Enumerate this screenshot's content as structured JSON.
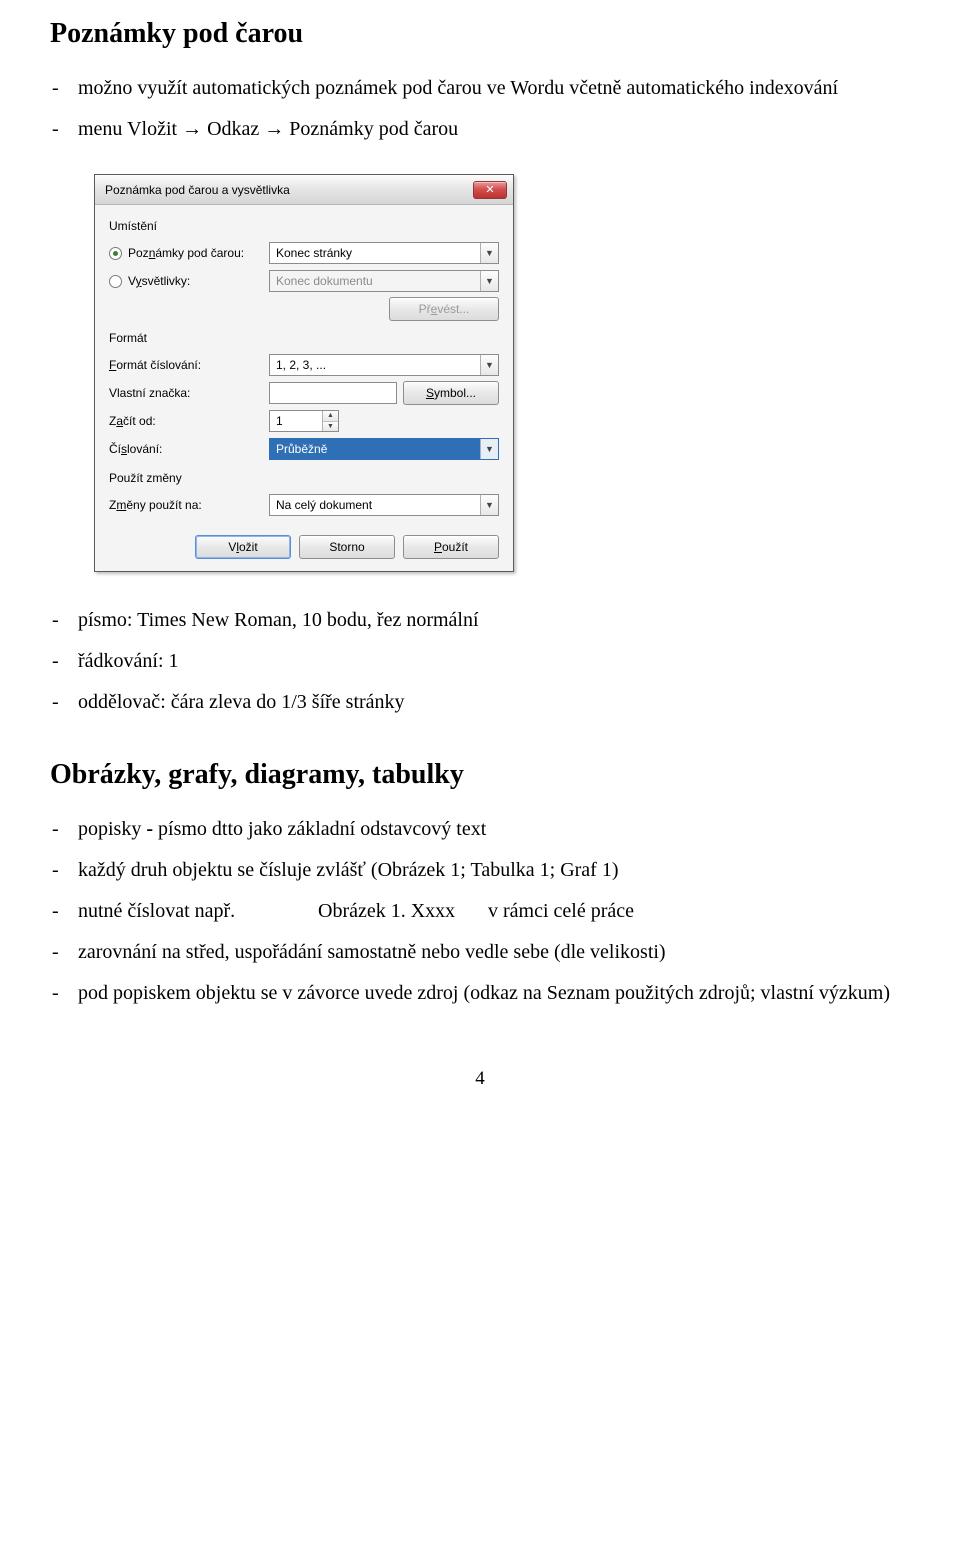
{
  "sections": {
    "footnotes_title": "Poznámky pod čarou",
    "footnotes_items": [
      "možno využít automatických poznámek pod čarou ve Wordu včetně automatického indexování",
      "menu Vložit → Odkaz → Poznámky pod čarou"
    ],
    "font_items": [
      "písmo: Times New Roman, 10 bodu, řez normální",
      "řádkování: 1",
      "oddělovač: čára zleva do 1/3 šíře stránky"
    ],
    "images_title": "Obrázky, grafy, diagramy, tabulky",
    "img_i1_pref": "popisky ",
    "img_i1_bold": "-",
    "img_i1_suf": " písmo dtto jako základní odstavcový text",
    "img_i2": "každý druh objektu se čísluje zvlášť (Obrázek 1; Tabulka 1; Graf 1)",
    "img_tab_c2": "nutné číslovat např.",
    "img_tab_c3": "Obrázek 1. Xxxx",
    "img_tab_c4": "v rámci celé práce",
    "img_i4": "zarovnání na střed, uspořádání samostatně nebo vedle sebe (dle velikosti)",
    "img_i5": "pod popiskem objektu se v závorce uvede zdroj (odkaz na Seznam použitých zdrojů; vlastní výzkum)"
  },
  "dialog": {
    "title": "Poznámka pod čarou a vysvětlivka",
    "group_location": "Umístění",
    "radio_footnotes_pre": "Poz",
    "radio_footnotes_u": "n",
    "radio_footnotes_post": "ámky pod čarou:",
    "radio_endnotes_pre": "V",
    "radio_endnotes_u": "y",
    "radio_endnotes_post": "světlivky:",
    "combo_footnotes_value": "Konec stránky",
    "combo_endnotes_value": "Konec dokumentu",
    "btn_convert_pre": "Př",
    "btn_convert_u": "e",
    "btn_convert_post": "vést...",
    "group_format": "Formát",
    "lbl_numfmt_u": "F",
    "lbl_numfmt_post": "ormát číslování:",
    "combo_numfmt_value": "1, 2, 3, ...",
    "lbl_custommark": "Vlastní značka:",
    "btn_symbol_u": "S",
    "btn_symbol_post": "ymbol...",
    "lbl_startat_pre": "Z",
    "lbl_startat_u": "a",
    "lbl_startat_post": "čít od:",
    "startat_value": "1",
    "lbl_numbering_pre": "Čí",
    "lbl_numbering_u": "s",
    "lbl_numbering_post": "lování:",
    "combo_numbering_value": "Průběžně",
    "group_apply": "Použít změny",
    "lbl_applyto_pre": "Z",
    "lbl_applyto_u": "m",
    "lbl_applyto_post": "ěny použít na:",
    "combo_applyto_value": "Na celý dokument",
    "btn_insert_pre": "V",
    "btn_insert_u": "l",
    "btn_insert_post": "ožit",
    "btn_cancel": "Storno",
    "btn_apply_u": "P",
    "btn_apply_post": "oužít",
    "close_glyph": "✕"
  },
  "page_number": "4"
}
